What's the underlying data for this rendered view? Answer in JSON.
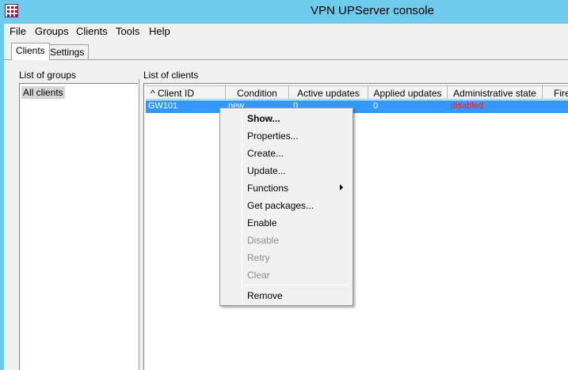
{
  "window": {
    "title": "VPN UPServer console",
    "app_icon": "app-grid-icon"
  },
  "menubar": [
    "File",
    "Groups",
    "Clients",
    "Tools",
    "Help"
  ],
  "tabs": {
    "active": "Clients",
    "other": "Settings"
  },
  "groups": {
    "heading": "List of groups",
    "items": [
      "All clients"
    ]
  },
  "clients": {
    "heading": "List of clients",
    "columns": [
      "^ Client ID",
      "Condition",
      "Active updates",
      "Applied updates",
      "Administrative state",
      "Fire"
    ],
    "rows": [
      {
        "client_id": "GW101",
        "condition": "new",
        "active_updates": "0",
        "applied_updates": "0",
        "admin_state": "disabled"
      }
    ]
  },
  "context_menu": {
    "items": [
      {
        "label": "Show...",
        "enabled": true,
        "default": true
      },
      {
        "label": "Properties...",
        "enabled": true
      },
      {
        "label": "Create...",
        "enabled": true
      },
      {
        "label": "Update...",
        "enabled": true
      },
      {
        "label": "Functions",
        "enabled": true,
        "submenu": true
      },
      {
        "label": "Get packages...",
        "enabled": true
      },
      {
        "label": "Enable",
        "enabled": true
      },
      {
        "label": "Disable",
        "enabled": false
      },
      {
        "label": "Retry",
        "enabled": false
      },
      {
        "label": "Clear",
        "enabled": false
      },
      {
        "label": "Remove",
        "enabled": true
      }
    ]
  },
  "colors": {
    "titlebar": "#6fc9ea",
    "selection": "#3399ff",
    "disabled_state": "#ff1a1a"
  }
}
